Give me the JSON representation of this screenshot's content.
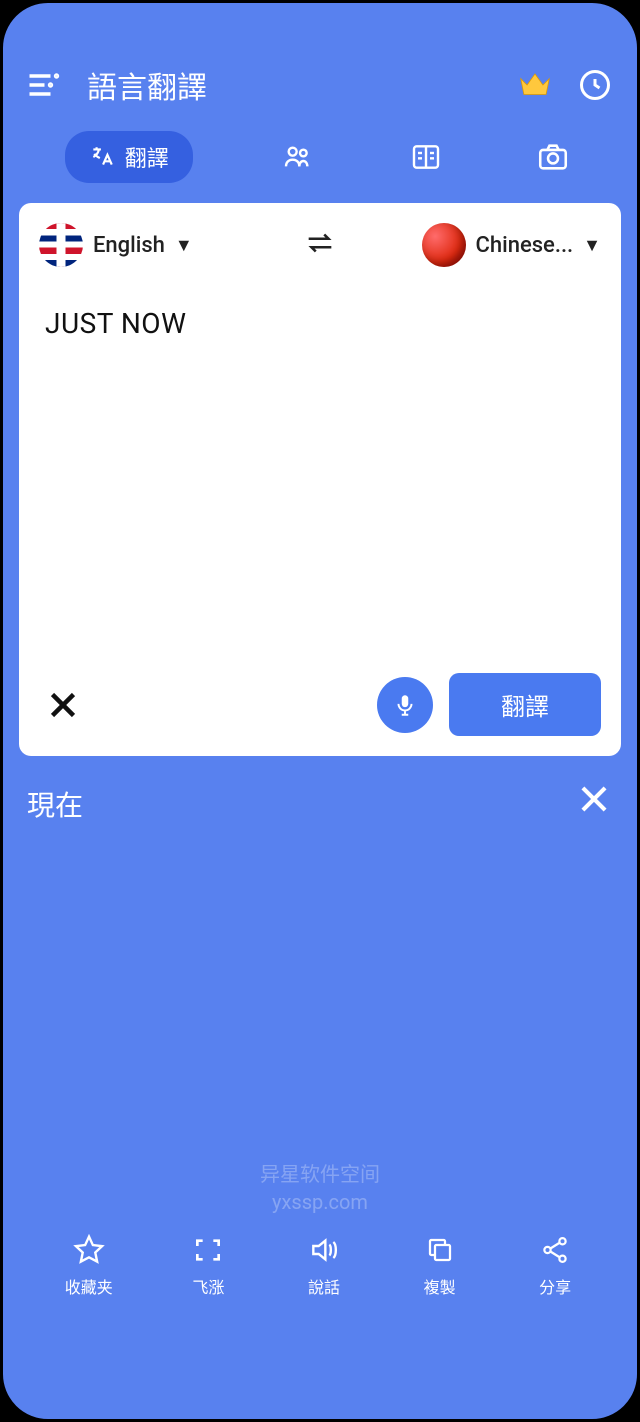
{
  "header": {
    "title": "語言翻譯"
  },
  "tabs": {
    "translate_label": "翻譯"
  },
  "languages": {
    "source": "English",
    "target": "Chinese..."
  },
  "input": {
    "text": "JUST NOW"
  },
  "controls": {
    "translate_button": "翻譯"
  },
  "output": {
    "text": "現在"
  },
  "watermark": {
    "line1": "异星软件空间",
    "line2": "yxssp.com"
  },
  "nav": {
    "items": [
      {
        "label": "收藏夹"
      },
      {
        "label": "飞涨"
      },
      {
        "label": "說話"
      },
      {
        "label": "複製"
      },
      {
        "label": "分享"
      }
    ]
  }
}
